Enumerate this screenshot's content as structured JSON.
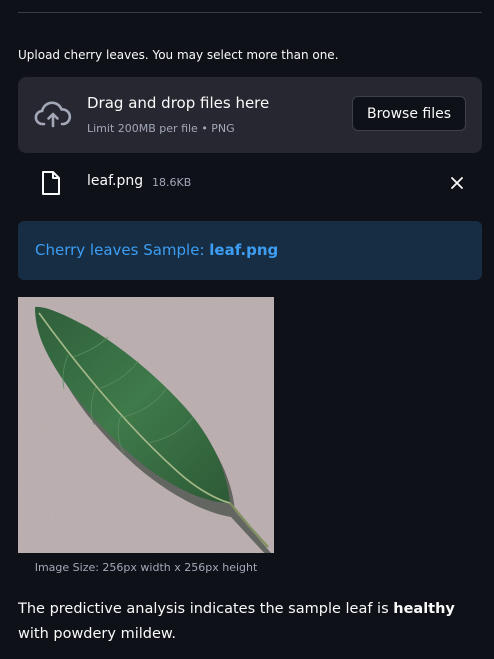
{
  "uploader": {
    "label": "Upload cherry leaves. You may select more than one.",
    "drop_title": "Drag and drop files here",
    "limit_text": "Limit 200MB per file • PNG",
    "browse_label": "Browse files",
    "upload_icon": "cloud-upload-icon"
  },
  "file": {
    "name": "leaf.png",
    "size": "18.6KB",
    "file_icon": "file-icon",
    "remove_icon": "close-icon"
  },
  "info": {
    "prefix": "Cherry leaves Sample: ",
    "filename": "leaf.png"
  },
  "image": {
    "caption": "Image Size: 256px width x 256px height"
  },
  "prediction": {
    "before": "The predictive analysis indicates the sample leaf is ",
    "label": "healthy",
    "after": " with powdery mildew."
  },
  "colors": {
    "background": "#0e1117",
    "dropzone": "#262730",
    "info_background": "#172d43",
    "info_text": "#3d9df3",
    "muted_text": "#a3a8b8"
  }
}
